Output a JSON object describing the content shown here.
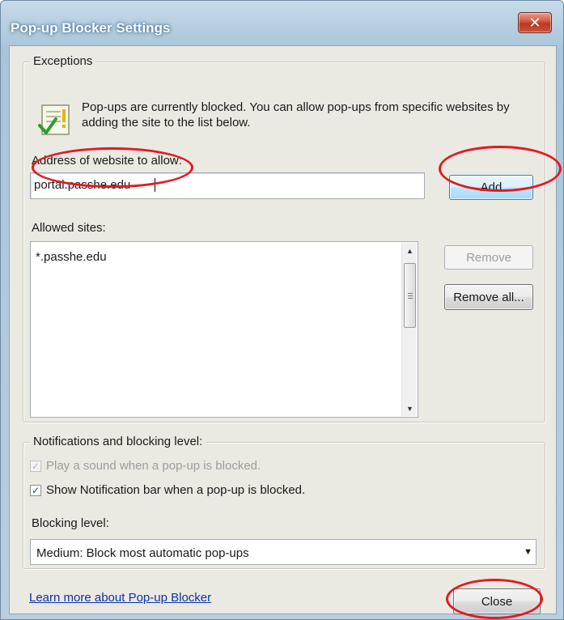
{
  "window": {
    "title": "Pop-up Blocker Settings",
    "close_glyph": "✕"
  },
  "exceptions": {
    "legend": "Exceptions",
    "info_text": "Pop-ups are currently blocked.  You can allow pop-ups from specific websites by adding the site to the list below.",
    "address_label": "Address of website to allow:",
    "address_value": "portal.passhe.edu",
    "add_label": "Add",
    "allowed_label": "Allowed sites:",
    "allowed_sites": [
      "*.passhe.edu"
    ],
    "remove_label": "Remove",
    "remove_all_label": "Remove all..."
  },
  "notifications": {
    "legend": "Notifications and blocking level:",
    "play_sound_label": "Play a sound when a pop-up is blocked.",
    "play_sound_checked": true,
    "show_bar_label": "Show Notification bar when a pop-up is blocked.",
    "show_bar_checked": true,
    "blocking_level_label": "Blocking level:",
    "blocking_level_value": "Medium: Block most automatic pop-ups"
  },
  "footer": {
    "learn_more_label": "Learn more about Pop-up Blocker",
    "close_label": "Close"
  },
  "colors": {
    "annotation_ring": "#e21a22",
    "link": "#0b33a6",
    "dialog_face": "#eae9e2"
  },
  "icons": [
    "info-check-icon",
    "close-x-icon",
    "scroll-up-icon",
    "scroll-down-icon",
    "dropdown-arrow-icon",
    "checkmark-icon"
  ]
}
